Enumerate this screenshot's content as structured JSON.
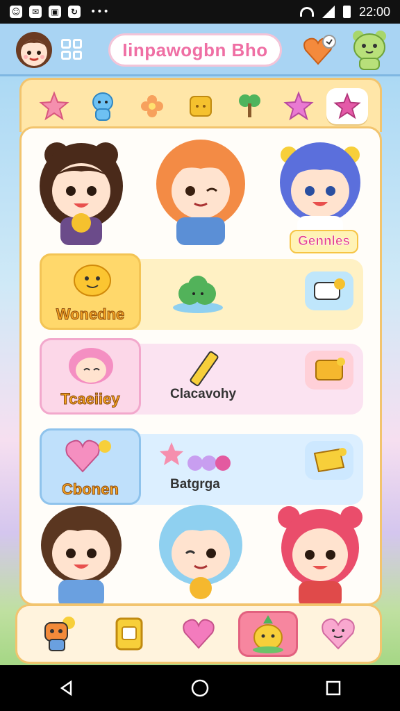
{
  "status_bar": {
    "time": "22:00",
    "notification_icons": [
      "whatsapp-icon",
      "notification-icon",
      "image-icon",
      "sync-icon"
    ]
  },
  "header": {
    "title": "Iinpawogbn Bho"
  },
  "tabs": [
    {
      "icon": "star-icon",
      "color": "#f58fae"
    },
    {
      "icon": "mascot-icon",
      "color": "#5db5ee"
    },
    {
      "icon": "flower-icon",
      "color": "#f79a56"
    },
    {
      "icon": "bread-icon",
      "color": "#f5c12e"
    },
    {
      "icon": "plant-icon",
      "color": "#4fb45d"
    },
    {
      "icon": "star-icon",
      "color": "#e97ad2"
    },
    {
      "icon": "star-icon",
      "color": "#e45aa8",
      "active": true
    }
  ],
  "characters_top": [
    {
      "icon": "brown-haired-girl-icon"
    },
    {
      "icon": "orange-haired-girl-icon"
    },
    {
      "icon": "blue-haired-girl-icon",
      "label": "Gennles"
    }
  ],
  "categories": [
    {
      "thumb_label": "Wonedne",
      "name": "",
      "theme": "#fff1c4",
      "border": "#f3c455"
    },
    {
      "thumb_label": "Tcaeiiey",
      "name": "Clacavohy",
      "theme": "#fbe3f1",
      "border": "#f2a8cc"
    },
    {
      "thumb_label": "Cbonen",
      "name": "Batgrga",
      "theme": "#dcefff",
      "border": "#8fc3ec"
    }
  ],
  "characters_bottom": [
    {
      "icon": "brown-haired-boy-icon"
    },
    {
      "icon": "light-blue-haired-girl-icon"
    },
    {
      "icon": "red-haired-girl-icon"
    }
  ],
  "bottom_nav": [
    {
      "icon": "robot-mascot-icon"
    },
    {
      "icon": "card-icon"
    },
    {
      "icon": "heart-icon"
    },
    {
      "icon": "pineapple-icon",
      "active": true
    },
    {
      "icon": "heart-face-icon"
    }
  ],
  "colors": {
    "accent_pink": "#ef6fa4",
    "panel_border": "#f2c46e",
    "header_blue": "#a9d4f3"
  }
}
